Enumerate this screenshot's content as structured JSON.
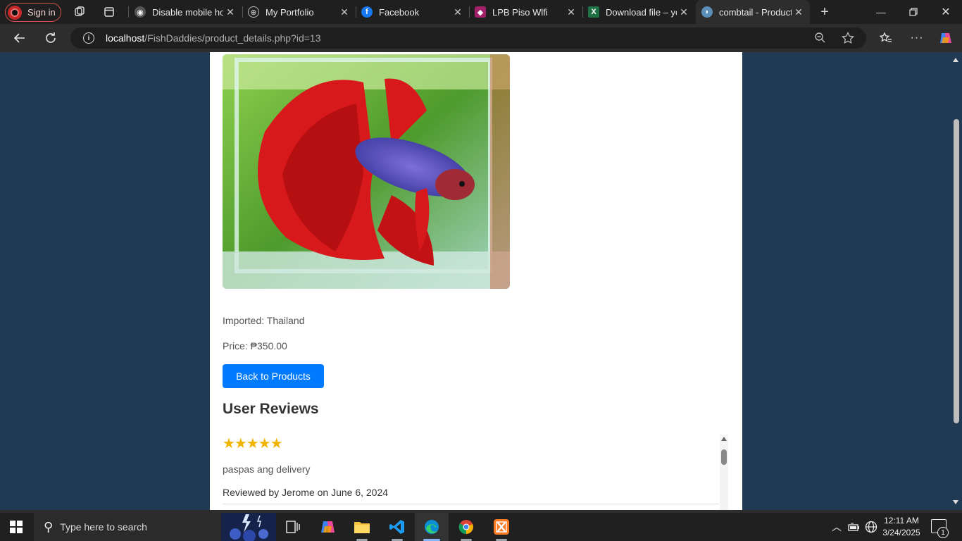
{
  "browser": {
    "signin_label": "Sign in",
    "tabs": [
      {
        "title": "Disable mobile hor",
        "icon": "github-icon",
        "active": false
      },
      {
        "title": "My Portfolio",
        "icon": "globe-icon",
        "active": false
      },
      {
        "title": "Facebook",
        "icon": "facebook-icon",
        "active": false
      },
      {
        "title": "LPB Piso Wlfi",
        "icon": "wifi-icon",
        "active": false
      },
      {
        "title": "Download file – yo",
        "icon": "excel-icon",
        "active": false
      },
      {
        "title": "combtail - Product",
        "icon": "fish-icon",
        "active": true
      }
    ],
    "url_host": "localhost",
    "url_path": "/FishDaddies/product_details.php?id=13"
  },
  "product": {
    "image_alt": "Red betta fish",
    "imported": "Imported: Thailand",
    "price": "Price: ₱350.00",
    "back_label": "Back to Products"
  },
  "reviews": {
    "heading": "User Reviews",
    "items": [
      {
        "stars": "★★★★★",
        "rating": 5,
        "text": "paspas ang delivery",
        "byline": "Reviewed by Jerome on June 6, 2024"
      }
    ]
  },
  "taskbar": {
    "search_placeholder": "Type here to search",
    "time": "12:11 AM",
    "date": "3/24/2025",
    "notifications": "1"
  },
  "colors": {
    "page_bg": "#1f3a52",
    "button": "#007bff",
    "star": "#f0b400"
  }
}
